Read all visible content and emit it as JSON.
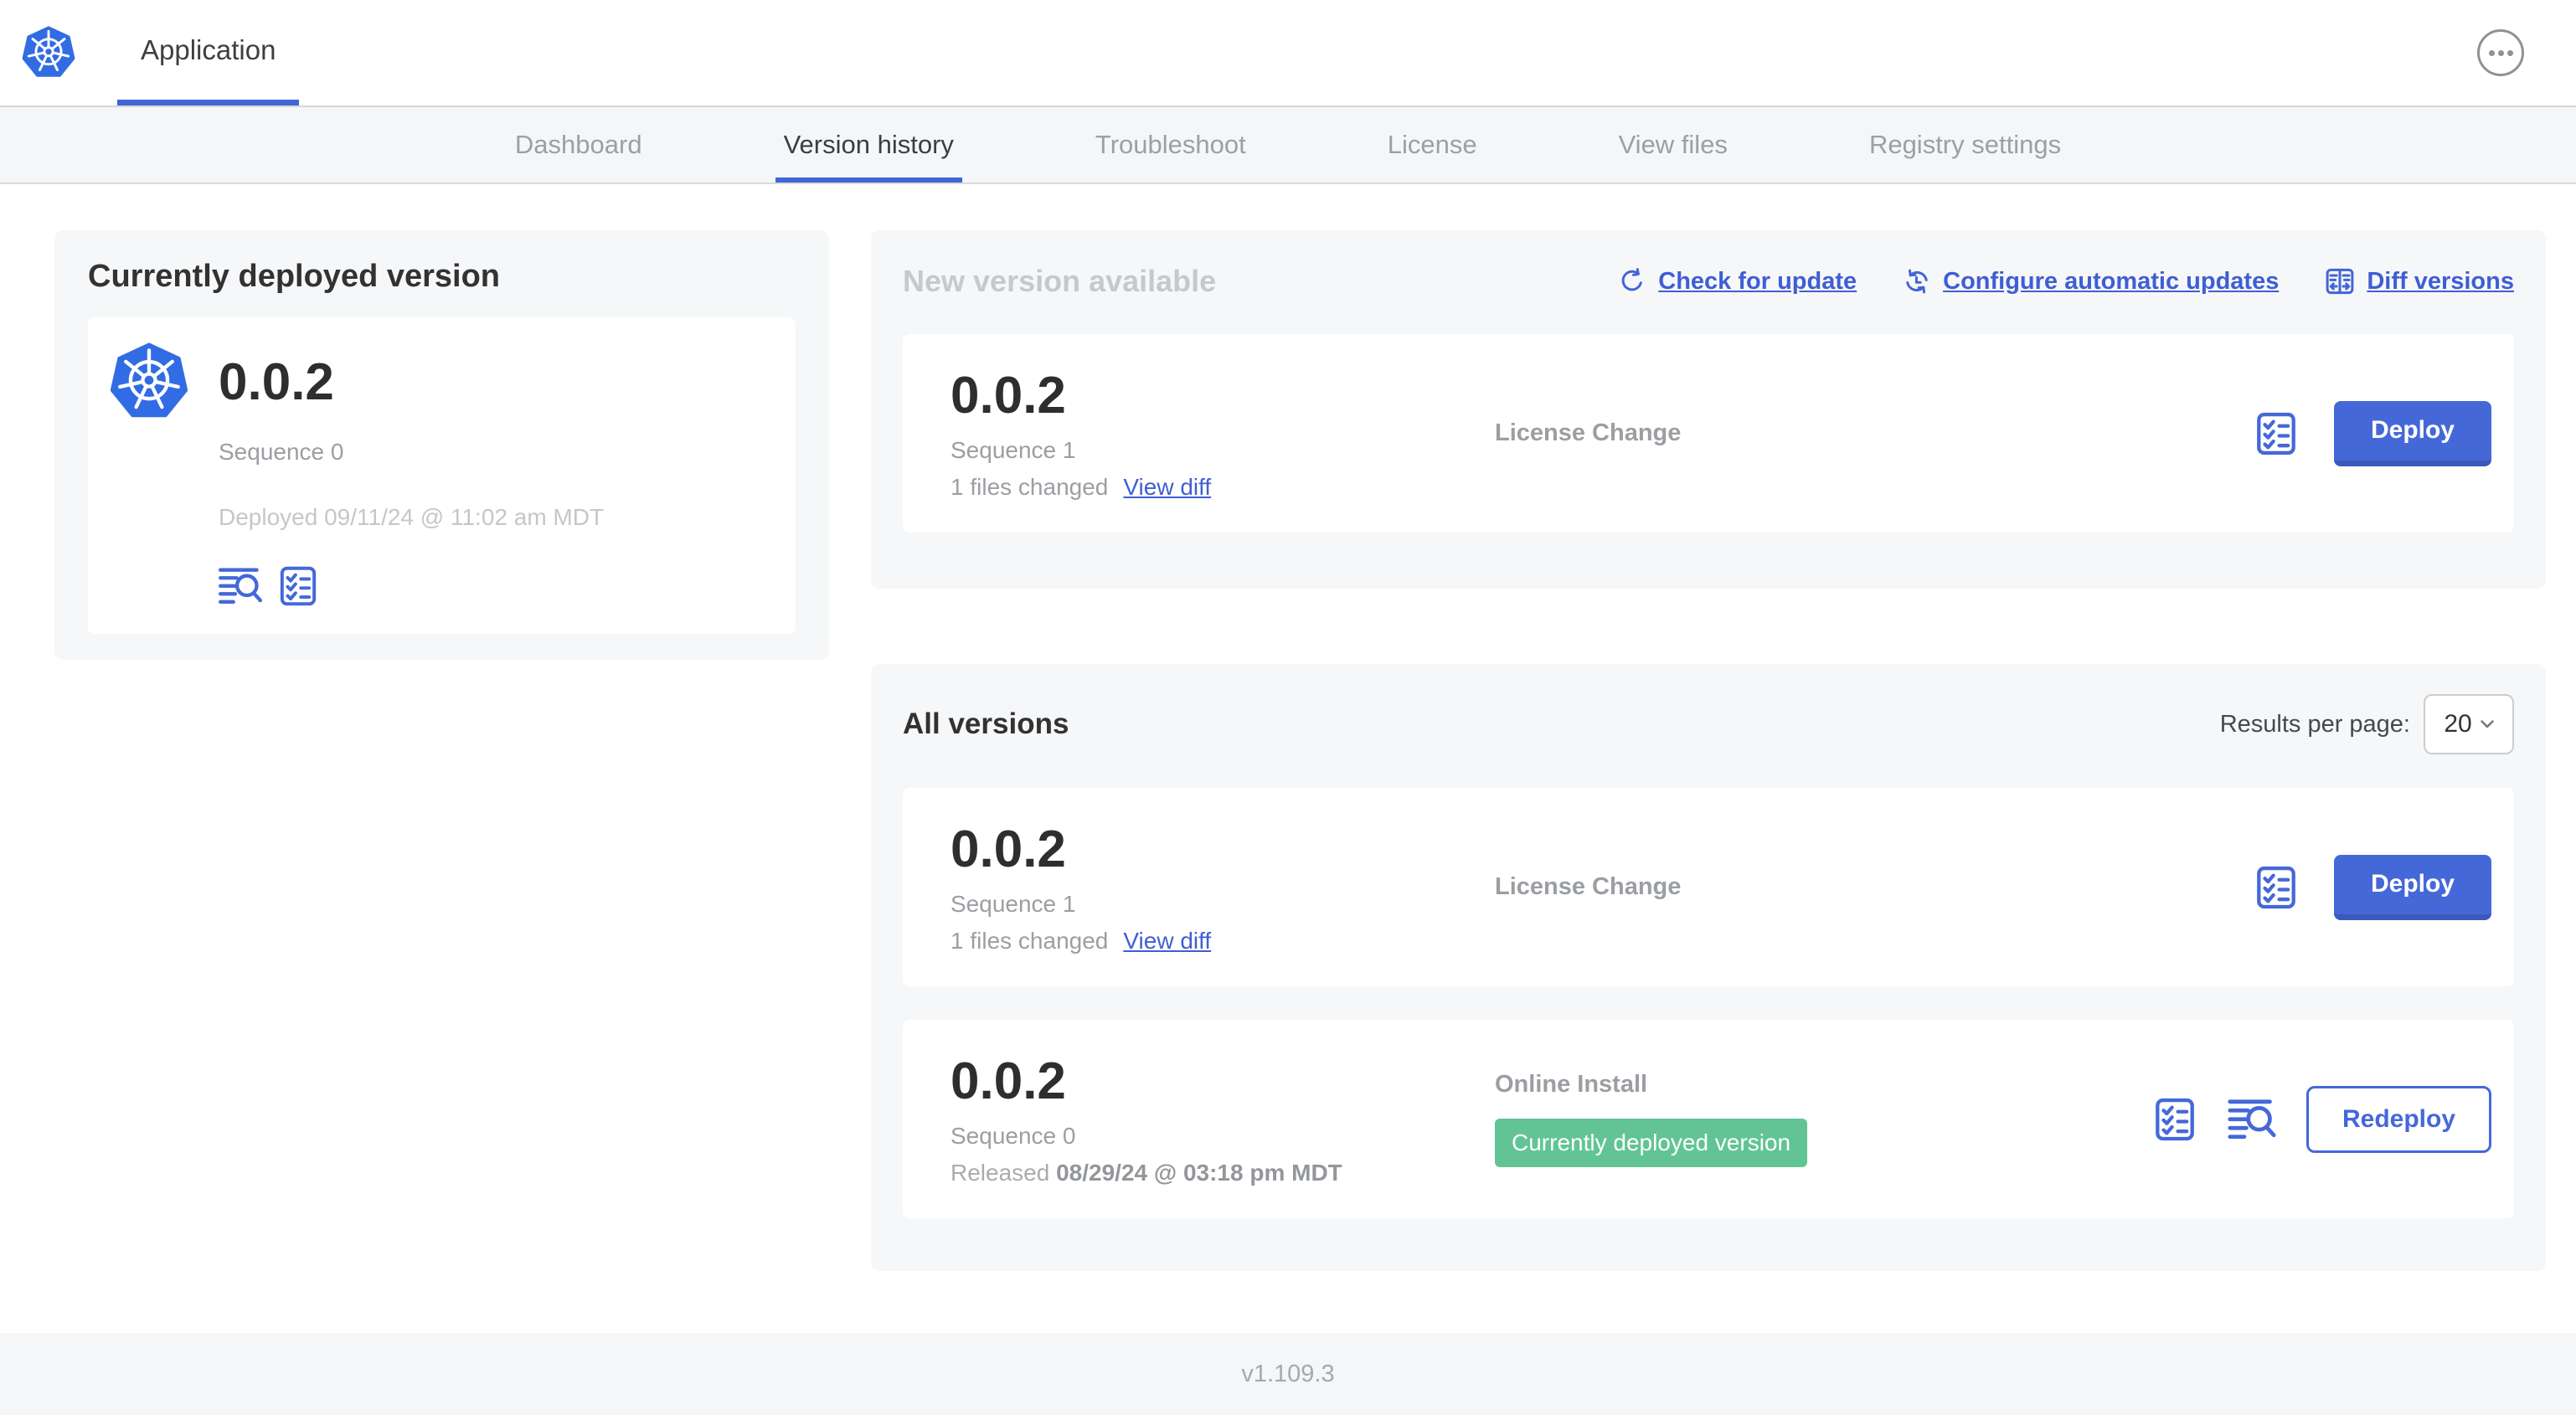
{
  "colors": {
    "primary_blue": "#4568d8",
    "primary_blue_shadow": "#3c58bb",
    "link_blue": "#3f5ed4",
    "kubernetes_blue": "#326ce5",
    "badge_green": "#62c495",
    "panel_gray": "#f6f7f9",
    "nav_gray": "#f5f6f8",
    "text_dark": "#2e2e2e",
    "text_gray": "#9b9ea2",
    "text_light_gray": "#c4c7ca"
  },
  "header": {
    "title": "Application"
  },
  "nav": {
    "tabs": [
      {
        "label": "Dashboard"
      },
      {
        "label": "Version history"
      },
      {
        "label": "Troubleshoot"
      },
      {
        "label": "License"
      },
      {
        "label": "View files"
      },
      {
        "label": "Registry settings"
      }
    ],
    "active_tab": "Version history"
  },
  "current_deployed": {
    "title": "Currently deployed version",
    "version": "0.0.2",
    "sequence": "Sequence 0",
    "deployed": "Deployed 09/11/24 @ 11:02 am MDT"
  },
  "new_version": {
    "title": "New version available",
    "links": {
      "check": "Check for update",
      "auto": "Configure automatic updates",
      "diff": "Diff versions"
    },
    "row": {
      "version": "0.0.2",
      "sequence": "Sequence 1",
      "files_changed": "1 files changed",
      "view_diff": "View diff",
      "source": "License Change",
      "action_label": "Deploy"
    }
  },
  "all_versions": {
    "title": "All versions",
    "results_label": "Results per page:",
    "results_value": "20",
    "rows": [
      {
        "version": "0.0.2",
        "sequence": "Sequence 1",
        "files_changed": "1 files changed",
        "view_diff": "View diff",
        "source": "License Change",
        "action_label": "Deploy"
      },
      {
        "version": "0.0.2",
        "sequence": "Sequence 0",
        "released_prefix": "Released",
        "released_date": "08/29/24 @ 03:18 pm MDT",
        "source": "Online Install",
        "badge": "Currently deployed version",
        "action_label": "Redeploy"
      }
    ]
  },
  "footer": {
    "app_version": "v1.109.3"
  }
}
